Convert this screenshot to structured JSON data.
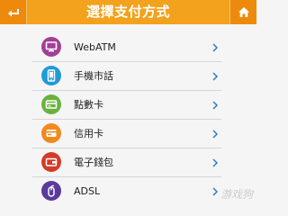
{
  "header": {
    "title": "選擇支付方式",
    "back_icon": "back-arrow-icon",
    "home_icon": "home-icon",
    "colors": {
      "bar": "#f2a21c",
      "button": "#ee8a0b"
    }
  },
  "payment_methods": [
    {
      "label": "WebATM",
      "icon": "monitor-icon",
      "color": "#a23f96"
    },
    {
      "label": "手機市話",
      "icon": "mobile-phone-icon",
      "color": "#1e9bd7"
    },
    {
      "label": "點數卡",
      "icon": "card-icon",
      "color": "#6ab23d"
    },
    {
      "label": "信用卡",
      "icon": "credit-card-icon",
      "color": "#f08a1d"
    },
    {
      "label": "電子錢包",
      "icon": "wallet-icon",
      "color": "#d63a27"
    },
    {
      "label": "ADSL",
      "icon": "mouse-icon",
      "color": "#5b3a9c"
    }
  ],
  "watermark": "游戏狗"
}
